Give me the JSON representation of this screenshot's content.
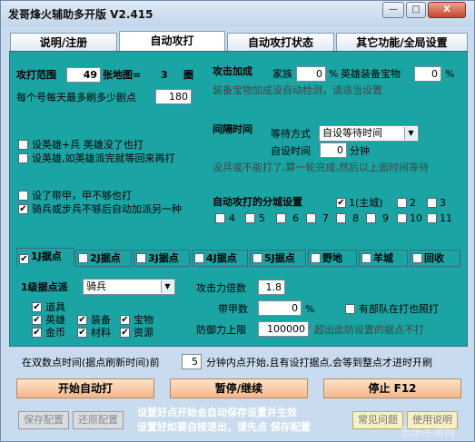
{
  "window": {
    "title": "发哥烽火辅助多开版   V2.415",
    "min": "—",
    "max": "□",
    "close": "X"
  },
  "tabs": [
    "说明/注册",
    "自动攻打",
    "自动攻打状态",
    "其它功能/全局设置"
  ],
  "attack": {
    "range_label": "攻打范围",
    "range_value": "49",
    "map_count_label": "张地图=",
    "map_count_value": "3",
    "ring_label": "圈",
    "min_points_label": "每个号每天最多刷多少剧点",
    "min_points_value": "180",
    "opt1": "设英雄+兵 英雄没了也打",
    "opt2": "设英雄,如英雄派完就等回来再打",
    "opt3": "设了带甲，甲不够也打",
    "opt4": "骑兵或步兵不够后自动加派另一种"
  },
  "bonus": {
    "title": "攻击加成",
    "family_label": "家族",
    "family_value": "0",
    "pct": "%",
    "hero_label": "英雄装备宝物",
    "hero_value": "0",
    "note": "装备宝物加成没自动检测，请适当设置"
  },
  "interval": {
    "title": "间隔时间",
    "wait_label": "等待方式",
    "wait_value": "自设等待时间",
    "custom_label": "自设时间",
    "custom_value": "0",
    "minute": "分钟",
    "note": "没兵或不能打了,算一轮完成,然后以上面时间等待"
  },
  "city": {
    "title": "自动攻打的分城设置",
    "items": [
      {
        "label": "1(主城)",
        "checked": true
      },
      {
        "label": "2"
      },
      {
        "label": "3"
      },
      {
        "label": "4"
      },
      {
        "label": "5"
      },
      {
        "label": "6"
      },
      {
        "label": "7"
      },
      {
        "label": "8"
      },
      {
        "label": "9"
      },
      {
        "label": "10"
      },
      {
        "label": "11"
      }
    ]
  },
  "subtabs": [
    {
      "label": "1J据点",
      "checked": true
    },
    {
      "label": "2J据点"
    },
    {
      "label": "3J据点"
    },
    {
      "label": "4J据点"
    },
    {
      "label": "5J据点"
    },
    {
      "label": "野地"
    },
    {
      "label": "羊城"
    },
    {
      "label": "回收"
    }
  ],
  "stronghold": {
    "dispatch_label": "1级据点派",
    "dispatch_value": "骑兵",
    "items": [
      {
        "label": "道具",
        "checked": true
      },
      {
        "label": "英雄",
        "checked": true
      },
      {
        "label": "装备",
        "checked": true
      },
      {
        "label": "宝物",
        "checked": true
      },
      {
        "label": "金币",
        "checked": true
      },
      {
        "label": "材料",
        "checked": true
      },
      {
        "label": "资源",
        "checked": true
      }
    ],
    "multiplier_label": "攻击力倍数",
    "multiplier_value": "1.8",
    "armor_label": "带甲数",
    "armor_value": "0",
    "armor_pct": "%",
    "ally_label": "有部队在打也照打",
    "def_label": "防御力上限",
    "def_value": "100000",
    "def_note": "超出此防设置的据点不打"
  },
  "refresh": {
    "label": "在双数点时间(据点刷新时间)前",
    "value": "5",
    "note": "分钟内点开始,且有设打据点,会等到整点才进时开刷"
  },
  "buttons": {
    "start": "开始自动打",
    "pause": "暂停/继续",
    "stop": "停止 F12",
    "save": "保存配置",
    "restore": "还原配置",
    "faq": "常见问题",
    "help": "使用说明"
  },
  "footer": {
    "line1": "设置好点开始会自动保存设置并生效",
    "line2": "设置好如要自接退出，请先点 保存配置"
  },
  "watermark": "乐乐手游网"
}
